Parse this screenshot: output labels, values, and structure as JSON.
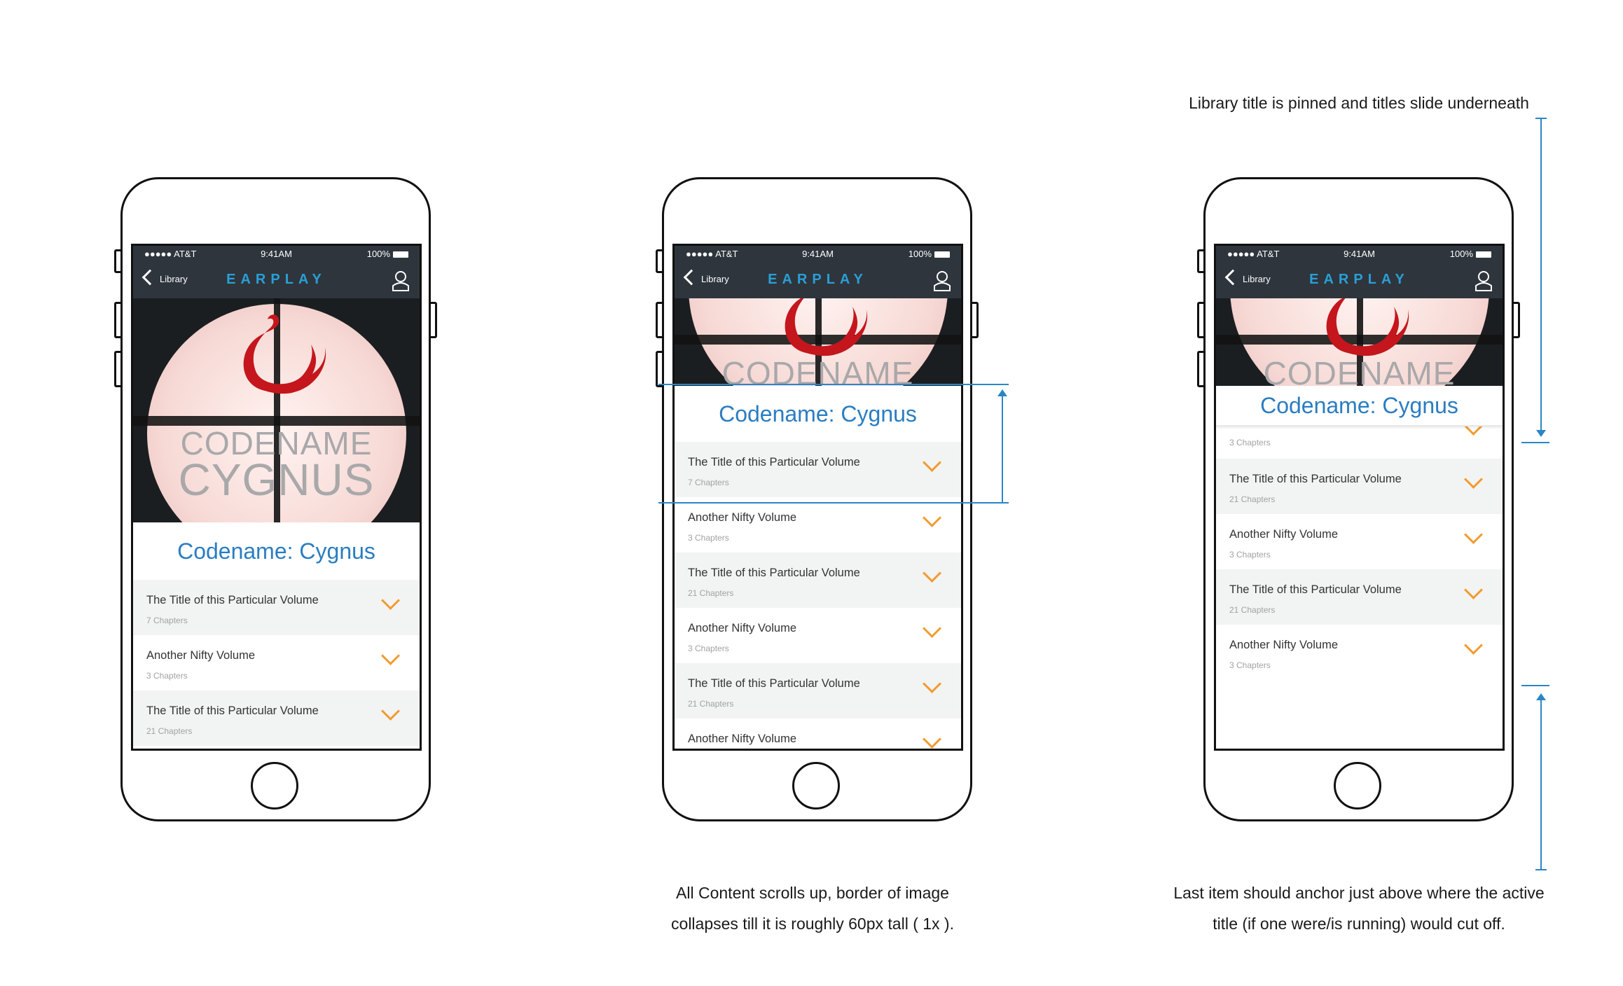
{
  "status": {
    "carrier": "●●●●● AT&T",
    "time": "9:41AM",
    "battery": "100%"
  },
  "nav": {
    "back_label": "Library",
    "logo": "EARPLAY"
  },
  "hero": {
    "line1": "CODENAME",
    "line2": "CYGNUS"
  },
  "book": {
    "title": "Codename: Cygnus"
  },
  "phone1": {
    "items": [
      {
        "title": "The Title of this Particular Volume",
        "sub": "7 Chapters"
      },
      {
        "title": "Another Nifty Volume",
        "sub": "3 Chapters"
      },
      {
        "title": "The Title of this Particular Volume",
        "sub": "21 Chapters"
      }
    ]
  },
  "phone2": {
    "items": [
      {
        "title": "The Title of this Particular Volume",
        "sub": "7 Chapters"
      },
      {
        "title": "Another Nifty Volume",
        "sub": "3 Chapters"
      },
      {
        "title": "The Title of this Particular Volume",
        "sub": "21 Chapters"
      },
      {
        "title": "Another Nifty Volume",
        "sub": "3 Chapters"
      },
      {
        "title": "The Title of this Particular Volume",
        "sub": "21 Chapters"
      },
      {
        "title": "Another Nifty Volume",
        "sub": ""
      }
    ]
  },
  "phone3": {
    "partial_sub": "3 Chapters",
    "items": [
      {
        "title": "The Title of this Particular Volume",
        "sub": "21 Chapters"
      },
      {
        "title": "Another Nifty Volume",
        "sub": "3 Chapters"
      },
      {
        "title": "The Title of this Particular Volume",
        "sub": "21 Chapters"
      },
      {
        "title": "Another Nifty Volume",
        "sub": "3 Chapters"
      }
    ]
  },
  "captions": {
    "top_right": "Library title is pinned and titles slide underneath",
    "bottom_middle_line1": "All Content scrolls up, border of image",
    "bottom_middle_line2": "collapses till it is roughly 60px tall ( 1x ).",
    "bottom_right_line1": "Last item should anchor just above where the active",
    "bottom_right_line2": "title (if one were/is running) would cut off."
  },
  "colors": {
    "accent_blue": "#2a7dc1",
    "logo_blue": "#2a9fd6",
    "chevron_orange": "#f29a2e",
    "bar_dark": "#2e353d"
  }
}
